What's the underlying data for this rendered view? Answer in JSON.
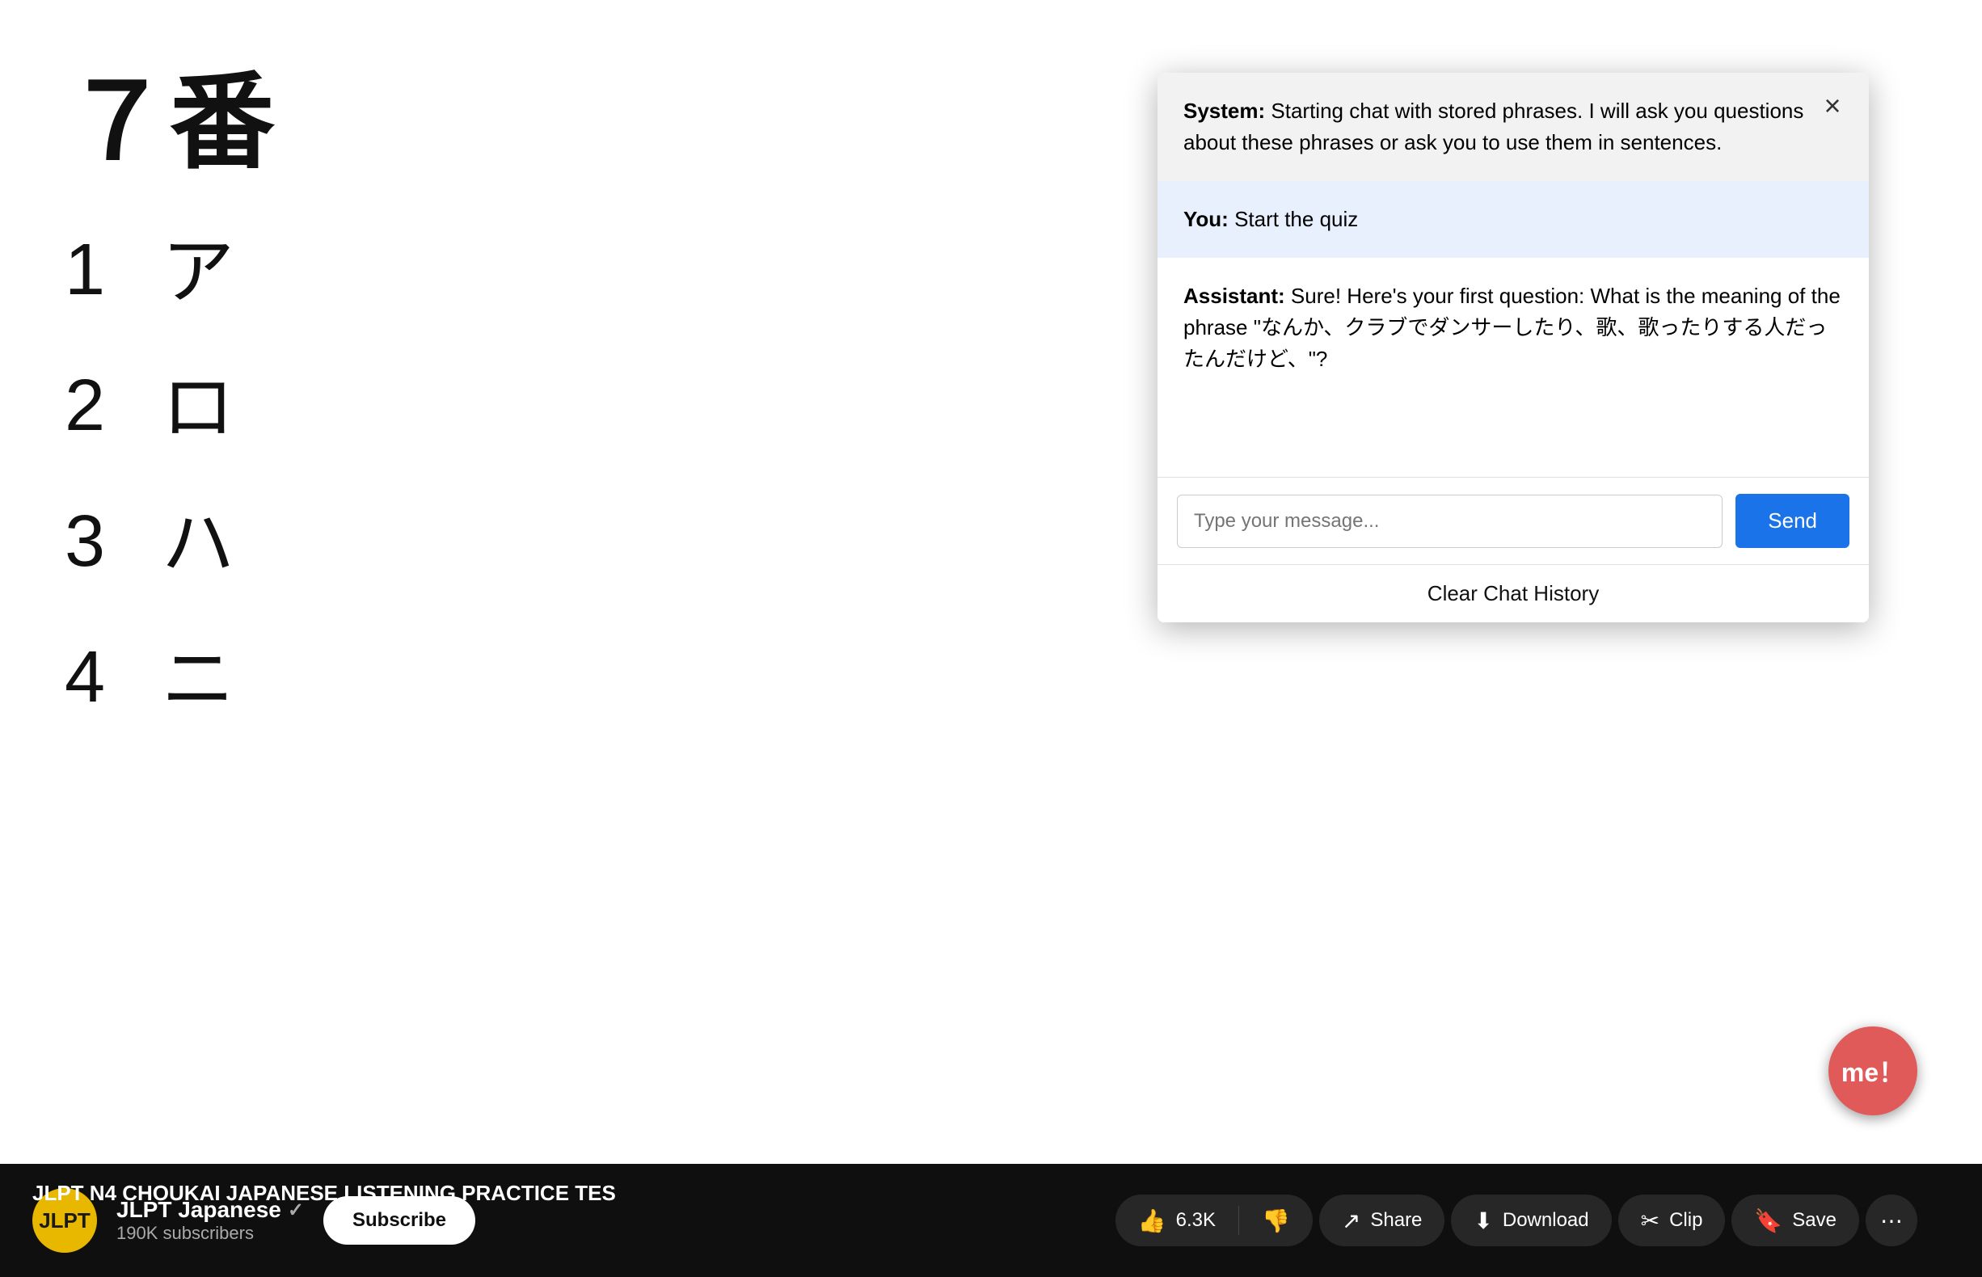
{
  "video": {
    "question_number": "７番",
    "options": [
      {
        "number": "1",
        "text": "ア"
      },
      {
        "number": "2",
        "text": "ロ"
      },
      {
        "number": "3",
        "text": "ハ"
      },
      {
        "number": "4",
        "text": "ニ"
      }
    ]
  },
  "channel": {
    "name": "JLPT Japanese",
    "subscriber_count": "190K subscribers",
    "avatar_text": "JLPT"
  },
  "video_title": "JLPT N4 CHOUKAI JAPANESE LISTENING PRACTICE TES",
  "actions": {
    "like": {
      "label": "6.3K",
      "icon": "👍"
    },
    "dislike": {
      "icon": "👎"
    },
    "share": {
      "label": "Share"
    },
    "download": {
      "label": "Download"
    },
    "clip": {
      "label": "Clip"
    },
    "save": {
      "label": "Save"
    },
    "subscribe_label": "Subscribe"
  },
  "chat": {
    "close_icon": "×",
    "messages": [
      {
        "type": "system",
        "sender": "System:",
        "text": " Starting chat with stored phrases. I will ask you questions about these phrases or ask you to use them in sentences."
      },
      {
        "type": "user",
        "sender": "You:",
        "text": " Start the quiz"
      },
      {
        "type": "assistant",
        "sender": "Assistant:",
        "text": " Sure! Here's your first question: What is the meaning of the phrase \"なんか、クラブでダンサーしたり、歌、歌ったりする人だったんだけど、\"?"
      }
    ],
    "input_placeholder": "Type your message...",
    "send_label": "Send",
    "clear_label": "Clear Chat History"
  },
  "me_button": {
    "label": "me！"
  }
}
